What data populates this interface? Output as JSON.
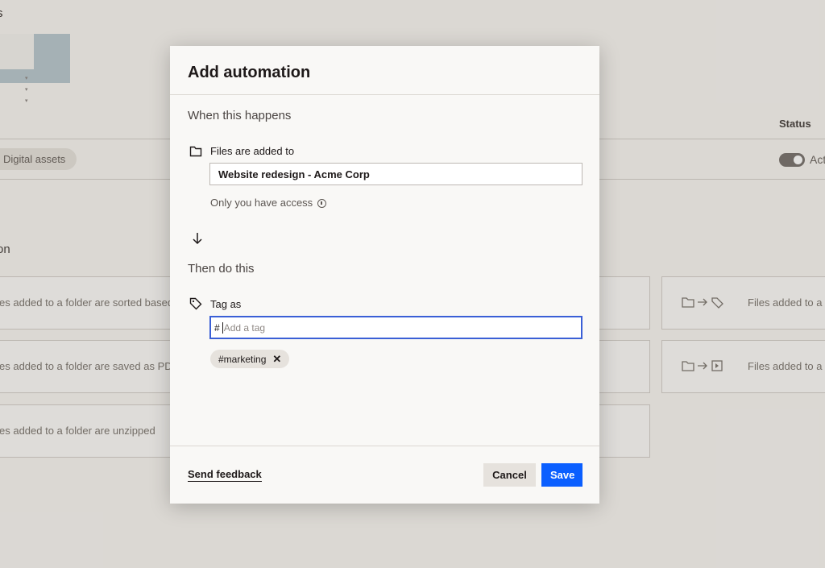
{
  "background": {
    "title_fragment": "s",
    "status_header": "Status",
    "chip_label": "Digital assets",
    "toggle_label": "Act",
    "section_fragment": "on",
    "cards": [
      {
        "text": "es added to a folder are sorted based"
      },
      {
        "text": "es added to a folder are saved as PDF"
      },
      {
        "text": "es added to a folder are unzipped"
      }
    ],
    "right_cards": [
      {
        "text": "Files added to a"
      },
      {
        "text": "Files added to a"
      }
    ]
  },
  "modal": {
    "title": "Add automation",
    "when_heading": "When this happens",
    "trigger_label": "Files are added to",
    "folder_value": "Website redesign - Acme Corp",
    "access_text": "Only you have access",
    "then_heading": "Then do this",
    "action_label": "Tag as",
    "tag_prefix": "#",
    "tag_placeholder": "Add a tag",
    "tags": [
      "#marketing"
    ],
    "feedback_label": "Send feedback",
    "cancel_label": "Cancel",
    "save_label": "Save",
    "colors": {
      "primary": "#0b5fff",
      "focus_border": "#3a5fd6"
    }
  }
}
